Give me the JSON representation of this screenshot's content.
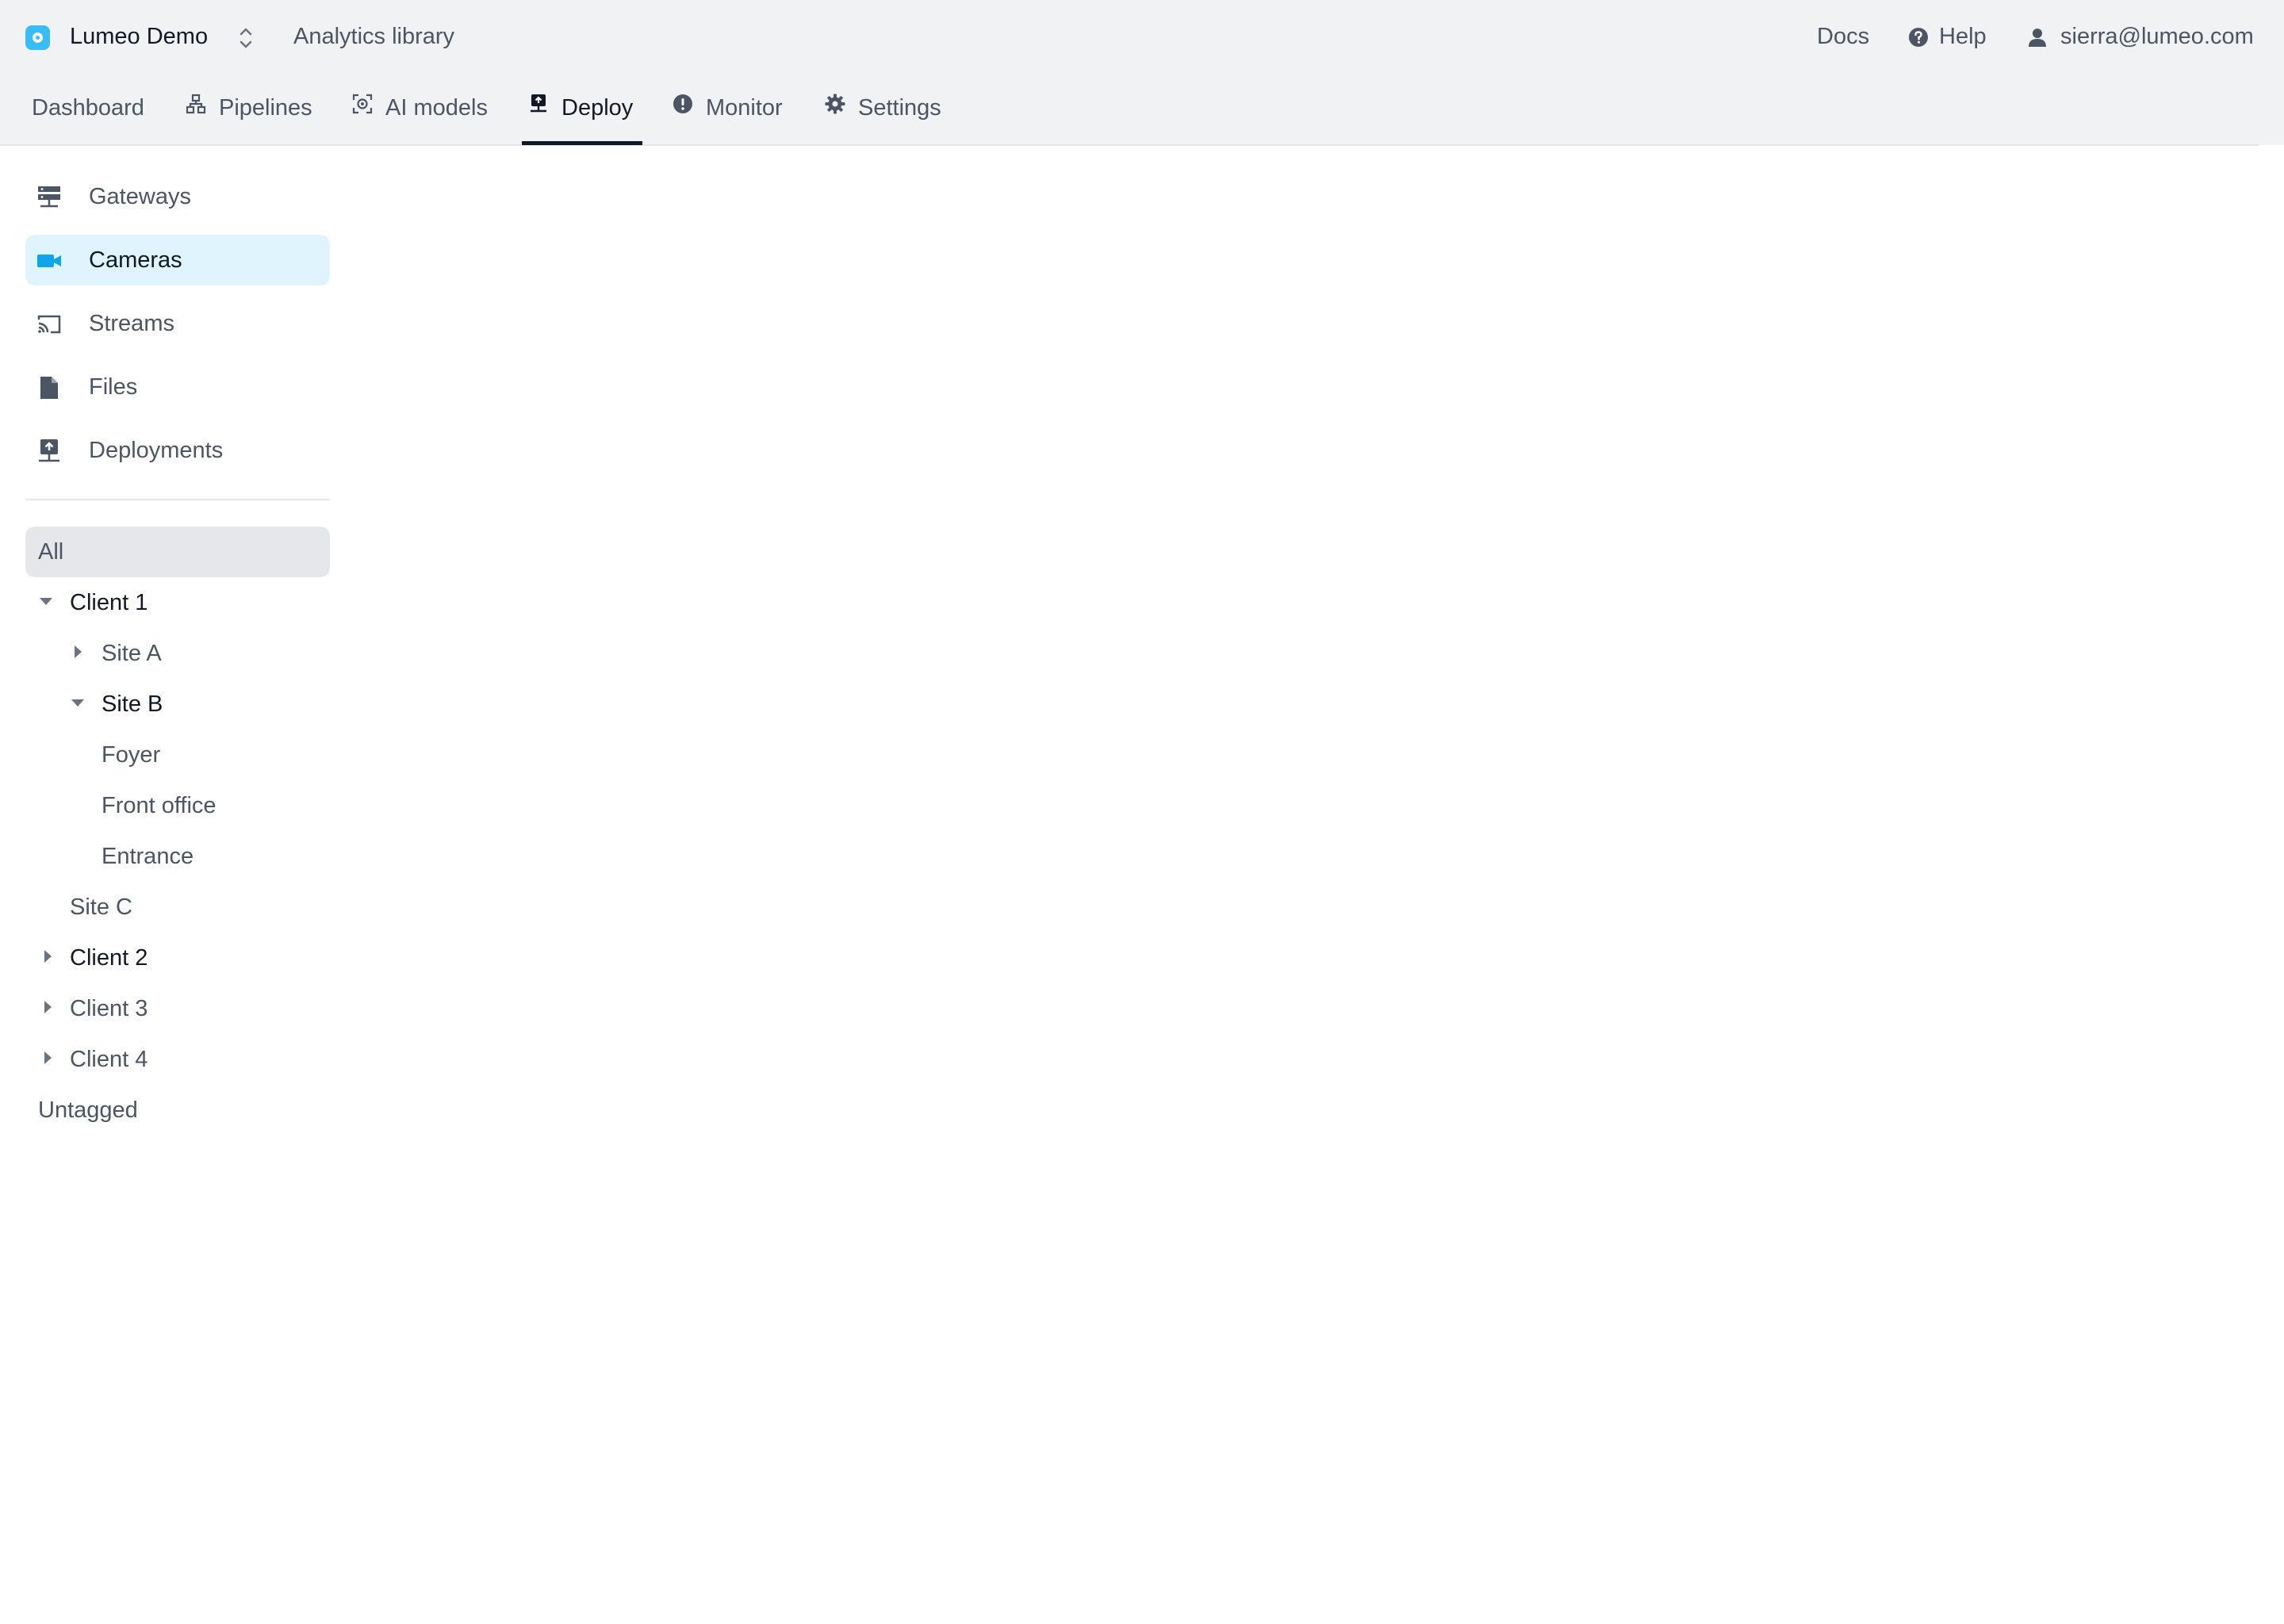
{
  "header": {
    "org_name": "Lumeo Demo",
    "analytics_link": "Analytics library",
    "docs_link": "Docs",
    "help_link": "Help",
    "user_email": "sierra@lumeo.com"
  },
  "tabs": [
    {
      "label": "Dashboard",
      "icon": "none"
    },
    {
      "label": "Pipelines",
      "icon": "pipelines-icon"
    },
    {
      "label": "AI models",
      "icon": "ai-models-icon"
    },
    {
      "label": "Deploy",
      "icon": "deploy-icon",
      "active": true
    },
    {
      "label": "Monitor",
      "icon": "alert-circle-icon"
    },
    {
      "label": "Settings",
      "icon": "gear-icon"
    }
  ],
  "sidebar": {
    "items": [
      {
        "label": "Gateways",
        "icon": "server-icon"
      },
      {
        "label": "Cameras",
        "icon": "video-camera-icon",
        "active": true
      },
      {
        "label": "Streams",
        "icon": "cast-icon"
      },
      {
        "label": "Files",
        "icon": "file-icon"
      },
      {
        "label": "Deployments",
        "icon": "deploy-icon"
      }
    ]
  },
  "tree": {
    "all": "All",
    "nodes": [
      {
        "label": "Client 1",
        "state": "expanded"
      },
      {
        "label": "Site A",
        "state": "collapsed"
      },
      {
        "label": "Site B",
        "state": "expanded"
      },
      {
        "label": "Foyer",
        "state": "leaf"
      },
      {
        "label": "Front office",
        "state": "leaf"
      },
      {
        "label": "Entrance",
        "state": "leaf"
      },
      {
        "label": "Site C",
        "state": "leaf"
      },
      {
        "label": "Client 2",
        "state": "collapsed"
      },
      {
        "label": "Client 3",
        "state": "collapsed"
      },
      {
        "label": "Client 4",
        "state": "collapsed"
      }
    ],
    "untagged": "Untagged"
  },
  "colors": {
    "accent": "#0ea5e9",
    "active_bg": "#e0f4fd",
    "topbar_bg": "#f1f2f4"
  }
}
